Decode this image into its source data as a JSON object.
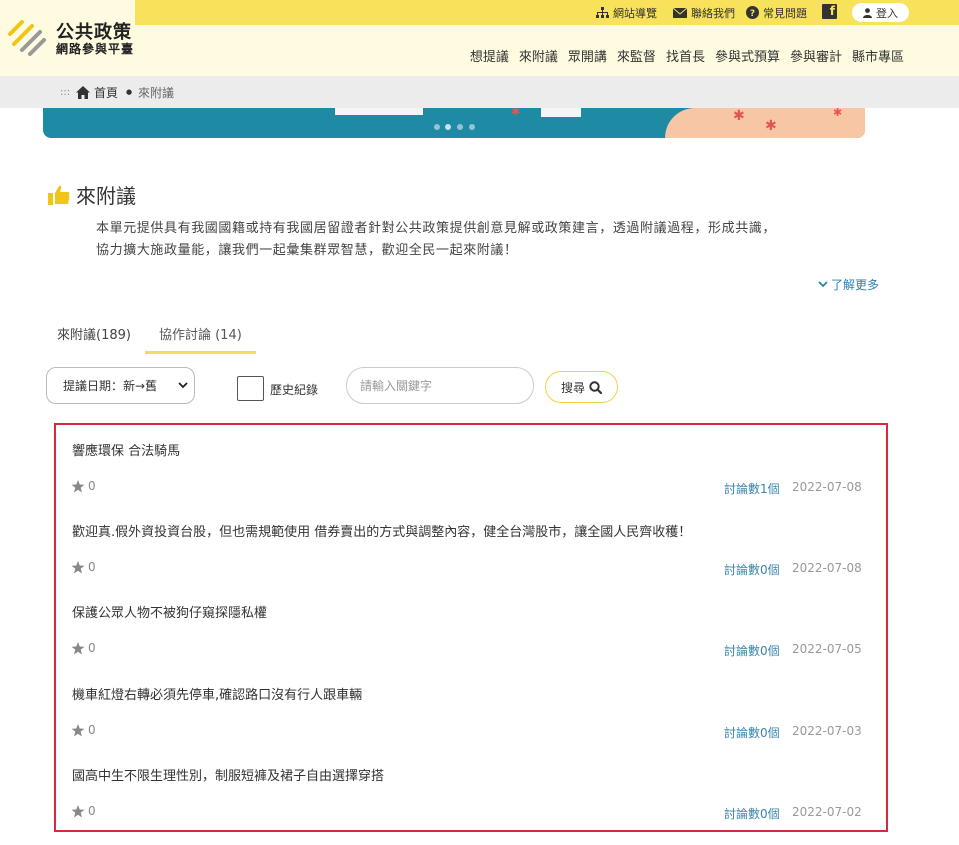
{
  "header": {
    "logo_line1": "公共政策",
    "logo_line2": "網路參與平臺",
    "util": {
      "sitemap": "網站導覽",
      "contact": "聯絡我們",
      "faq": "常見問題",
      "login": "登入"
    },
    "nav": [
      "想提議",
      "來附議",
      "眾開講",
      "來監督",
      "找首長",
      "參與式預算",
      "參與審計",
      "縣市專區"
    ]
  },
  "breadcrumb": {
    "dots": ":::",
    "home": "首頁",
    "current": "來附議"
  },
  "section": {
    "title": "來附議",
    "intro_line1": "本單元提供具有我國國籍或持有我國居留證者針對公共政策提供創意見解或政策建言，透過附議過程，形成共識，",
    "intro_line2": "協力擴大施政量能，讓我們一起彙集群眾智慧，歡迎全民一起來附議！",
    "more": "了解更多"
  },
  "tabs": [
    {
      "label": "來附議(189)",
      "active": false
    },
    {
      "label": "協作討論 (14)",
      "active": true
    }
  ],
  "filters": {
    "sort_value": "提議日期：新→舊",
    "history_label": "歷史紀錄",
    "search_placeholder": "請輸入關鍵字",
    "search_button": "搜尋"
  },
  "items": [
    {
      "title": "響應環保 合法騎馬",
      "stars": "0",
      "discussions": "討論數1個",
      "date": "2022-07-08"
    },
    {
      "title": "歡迎真.假外資投資台股，但也需規範使用 借券賣出的方式與調整內容，健全台灣股市，讓全國人民齊收穫！",
      "stars": "0",
      "discussions": "討論數0個",
      "date": "2022-07-08"
    },
    {
      "title": "保護公眾人物不被狗仔窺探隱私權",
      "stars": "0",
      "discussions": "討論數0個",
      "date": "2022-07-05"
    },
    {
      "title": "機車紅燈右轉必須先停車,確認路口沒有行人跟車輛",
      "stars": "0",
      "discussions": "討論數0個",
      "date": "2022-07-03"
    },
    {
      "title": "國高中生不限生理性別，制服短褲及裙子自由選擇穿搭",
      "stars": "0",
      "discussions": "討論數0個",
      "date": "2022-07-02"
    }
  ],
  "colors": {
    "brand_yellow": "#f8e15b",
    "header_bg": "#fffbe0",
    "link_blue": "#3a85ab",
    "highlight_red": "#d9283b"
  }
}
